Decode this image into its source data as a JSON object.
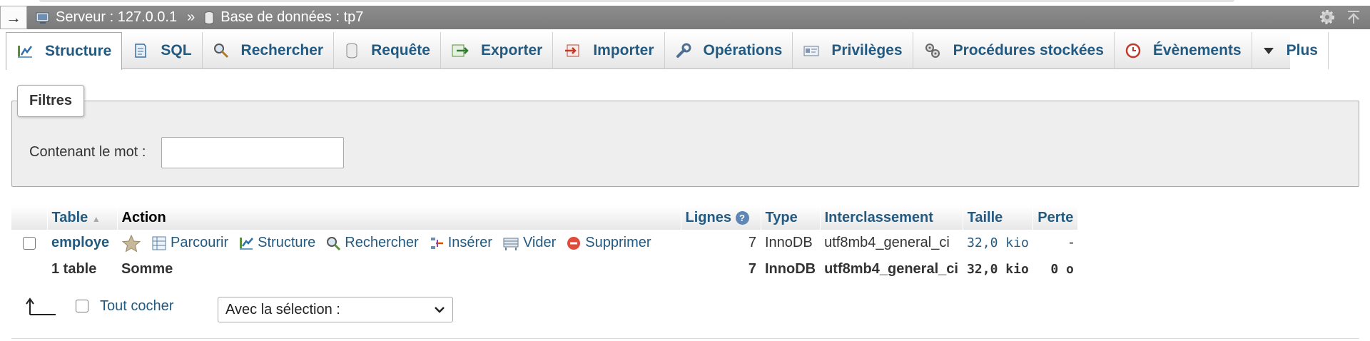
{
  "breadcrumb": {
    "toggle": "→",
    "server": "Serveur : 127.0.0.1",
    "separator": "»",
    "database": "Base de données : tp7"
  },
  "tabs": [
    {
      "label": "Structure",
      "icon": "structure-icon",
      "active": true
    },
    {
      "label": "SQL",
      "icon": "sql-icon"
    },
    {
      "label": "Rechercher",
      "icon": "search-icon"
    },
    {
      "label": "Requête",
      "icon": "query-icon"
    },
    {
      "label": "Exporter",
      "icon": "export-icon"
    },
    {
      "label": "Importer",
      "icon": "import-icon"
    },
    {
      "label": "Opérations",
      "icon": "wrench-icon"
    },
    {
      "label": "Privilèges",
      "icon": "privileges-icon"
    },
    {
      "label": "Procédures stockées",
      "icon": "routines-icon"
    },
    {
      "label": "Évènements",
      "icon": "events-icon"
    },
    {
      "label": "Plus",
      "icon": "caret-down-icon"
    }
  ],
  "filters": {
    "legend": "Filtres",
    "label": "Contenant le mot :",
    "value": ""
  },
  "table": {
    "headers": {
      "table": "Table",
      "action": "Action",
      "rows": "Lignes",
      "type": "Type",
      "collation": "Interclassement",
      "size": "Taille",
      "overhead": "Perte"
    },
    "row": {
      "name": "employe",
      "actions": [
        "Parcourir",
        "Structure",
        "Rechercher",
        "Insérer",
        "Vider",
        "Supprimer"
      ],
      "rows": "7",
      "type": "InnoDB",
      "collation": "utf8mb4_general_ci",
      "size": "32,0 kio",
      "overhead": "-"
    },
    "summary": {
      "name": "1 table",
      "label": "Somme",
      "rows": "7",
      "type": "InnoDB",
      "collation": "utf8mb4_general_ci",
      "size": "32,0 kio",
      "overhead": "0 o"
    }
  },
  "bottom": {
    "check_all": "Tout cocher",
    "selection": "Avec la sélection :"
  },
  "colors": {
    "link": "#235a81",
    "breadcrumb_bg": "#858585",
    "filters_bg": "#eeeeee"
  }
}
